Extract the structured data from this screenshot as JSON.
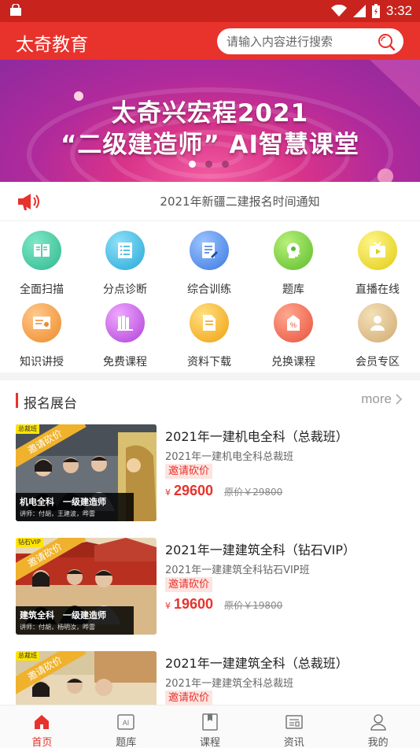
{
  "status_bar": {
    "time": "3:32"
  },
  "header": {
    "app_title": "太奇教育",
    "search_placeholder": "请输入内容进行搜索"
  },
  "banner": {
    "line1": "太奇兴宏程2021",
    "line2": "“二级建造师” AI智慧课堂",
    "slides": 3,
    "active_slide": 0
  },
  "notice": {
    "text": "2021年新疆二建报名时间通知"
  },
  "grid": [
    {
      "label": "全面扫描",
      "icon": "book-icon",
      "color": "#3ec8a0"
    },
    {
      "label": "分点诊断",
      "icon": "checklist-icon",
      "color": "#3bb8e0"
    },
    {
      "label": "综合训练",
      "icon": "edit-doc-icon",
      "color": "#4a8ee8"
    },
    {
      "label": "题库",
      "icon": "head-icon",
      "color": "#7ccf3e"
    },
    {
      "label": "直播在线",
      "icon": "tv-icon",
      "color": "#e8d82a"
    },
    {
      "label": "知识讲授",
      "icon": "certificate-icon",
      "color": "#f09a3a"
    },
    {
      "label": "免费课程",
      "icon": "books-icon",
      "color": "#c860e0"
    },
    {
      "label": "资料下载",
      "icon": "file-icon",
      "color": "#f0b020"
    },
    {
      "label": "兑换课程",
      "icon": "coupon-icon",
      "color": "#f26a4a"
    },
    {
      "label": "会员专区",
      "icon": "member-icon",
      "color": "#e0c080"
    }
  ],
  "section": {
    "title": "报名展台",
    "more": "more"
  },
  "courses": [
    {
      "title": "2021年一建机电全科（总裁班）",
      "subtitle": "2021年一建机电全科总裁班",
      "badge": "邀请砍价",
      "currency": "¥",
      "price": "29600",
      "original": "原价￥29800",
      "thumb_tag": "总裁班",
      "thumb_ribbon": "邀请砍价",
      "thumb_caption": "机电全科　一级建造师",
      "thumb_teachers": "讲师：付胡，王建波，晔雷"
    },
    {
      "title": "2021年一建建筑全科（钻石VIP）",
      "subtitle": "2021年一建建筑全科钻石VIP班",
      "badge": "邀请砍价",
      "currency": "¥",
      "price": "19600",
      "original": "原价￥19800",
      "thumb_tag": "钻石VIP",
      "thumb_ribbon": "邀请砍价",
      "thumb_caption": "建筑全科　一级建造师",
      "thumb_teachers": "讲师：付胡，杨明汝，晔雷"
    },
    {
      "title": "2021年一建建筑全科（总裁班）",
      "subtitle": "2021年一建建筑全科总裁班",
      "badge": "邀请砍价",
      "currency": "¥",
      "price": "",
      "original": "",
      "thumb_tag": "总裁班",
      "thumb_ribbon": "邀请砍价",
      "thumb_caption": "",
      "thumb_teachers": ""
    }
  ],
  "bottom_nav": [
    {
      "label": "首页",
      "icon": "home-icon",
      "active": true
    },
    {
      "label": "题库",
      "icon": "ai-icon",
      "active": false
    },
    {
      "label": "课程",
      "icon": "bookmark-icon",
      "active": false
    },
    {
      "label": "资讯",
      "icon": "news-icon",
      "active": false
    },
    {
      "label": "我的",
      "icon": "user-icon",
      "active": false
    }
  ]
}
